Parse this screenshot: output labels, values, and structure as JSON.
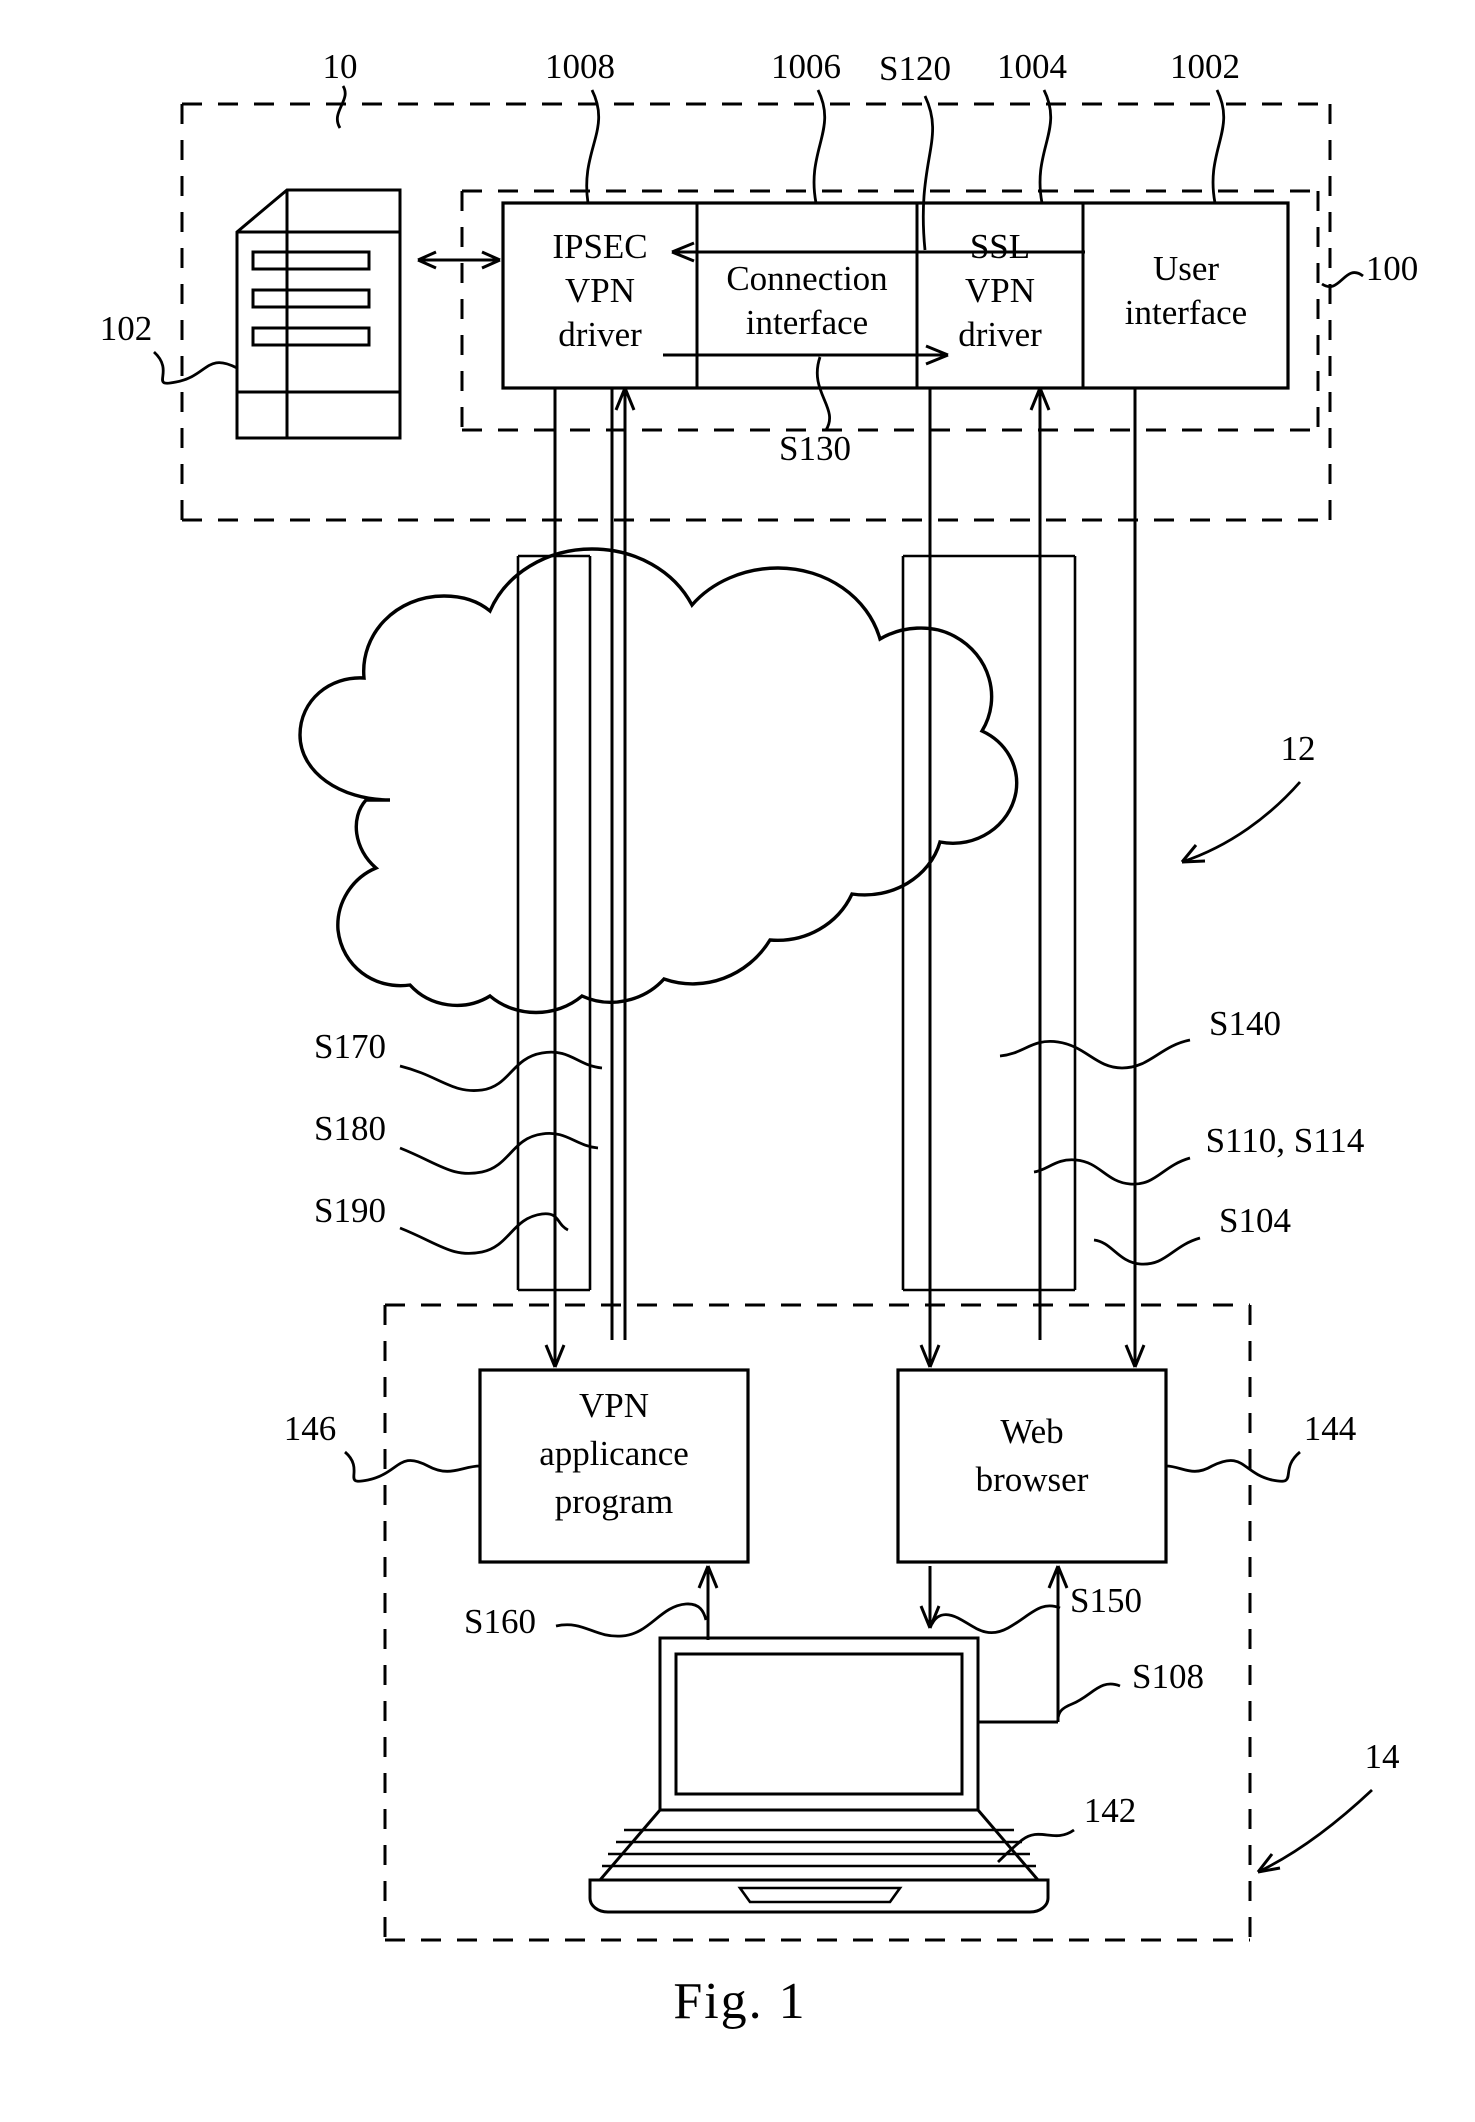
{
  "figure": {
    "caption": "Fig. 1",
    "title": "VPN connection system block diagram"
  },
  "reference_numerals": {
    "system": "10",
    "server": "102",
    "gateway_module": "100",
    "ipsec_vpn_driver": "1008",
    "connection_interface": "1006",
    "ssl_vpn_driver": "1004",
    "user_interface": "1002",
    "network_cloud": "12",
    "client_side": "14",
    "laptop": "142",
    "web_browser": "144",
    "vpn_appliance_program": "146"
  },
  "blocks": {
    "ipsec_vpn_driver": "IPSEC\nVPN\ndriver",
    "ipsec_vpn_driver_lines": [
      "IPSEC",
      "VPN",
      "driver"
    ],
    "connection_interface_lines": [
      "Connection",
      "interface"
    ],
    "ssl_vpn_driver_lines": [
      "SSL",
      "VPN",
      "driver"
    ],
    "user_interface_lines": [
      "User",
      "interface"
    ],
    "vpn_appliance_program_lines": [
      "VPN",
      "applicance",
      "program"
    ],
    "web_browser_lines": [
      "Web",
      "browser"
    ]
  },
  "steps": {
    "s120": "S120",
    "s130": "S130",
    "s140": "S140",
    "s170": "S170",
    "s180": "S180",
    "s190": "S190",
    "s110_s114": "S110, S114",
    "s104": "S104",
    "s150": "S150",
    "s108": "S108",
    "s160": "S160"
  },
  "colors": {
    "stroke": "#000000",
    "background": "#ffffff"
  }
}
